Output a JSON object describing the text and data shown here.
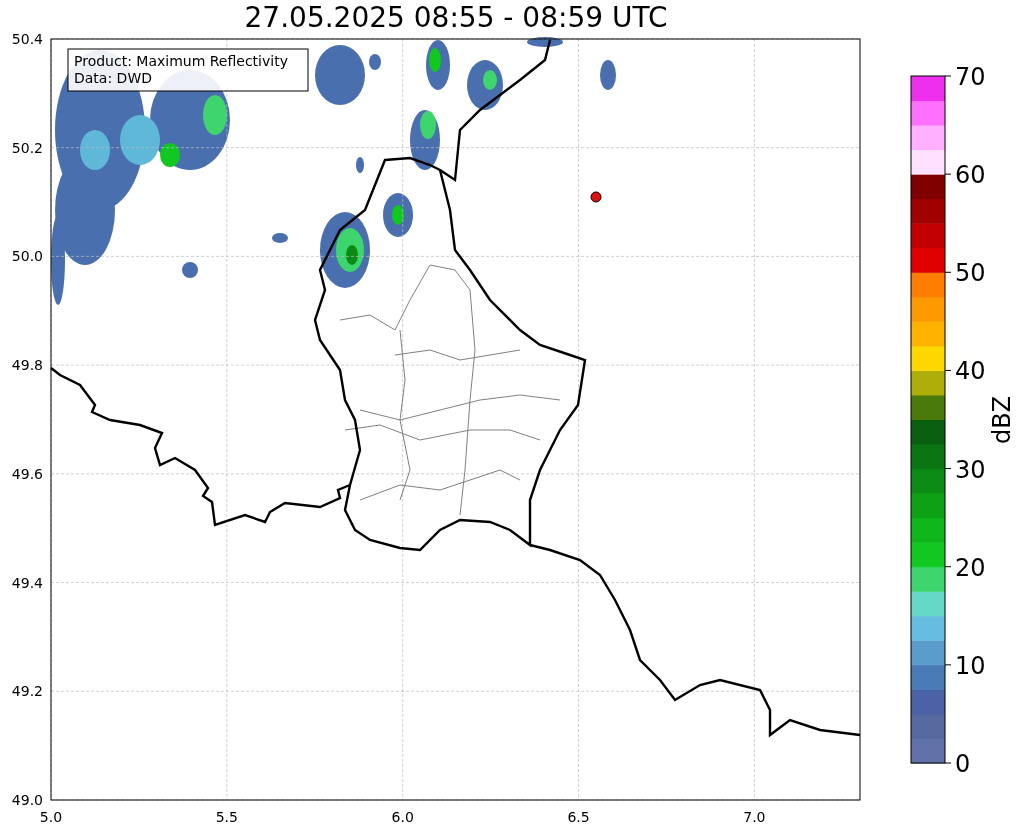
{
  "title": "27.05.2025 08:55 - 08:59 UTC",
  "legend": [
    "Product: Maximum Reflectivity",
    "Data: DWD"
  ],
  "x_ticks": [
    "5.0",
    "5.5",
    "6.0",
    "6.5",
    "7.0"
  ],
  "y_ticks": [
    "50.4",
    "50.2",
    "50.0",
    "49.8",
    "49.6",
    "49.4",
    "49.2",
    "49.0"
  ],
  "colorbar": {
    "ticks": [
      "70",
      "60",
      "50",
      "40",
      "30",
      "20",
      "10",
      "0"
    ],
    "label": "dBZ"
  }
}
